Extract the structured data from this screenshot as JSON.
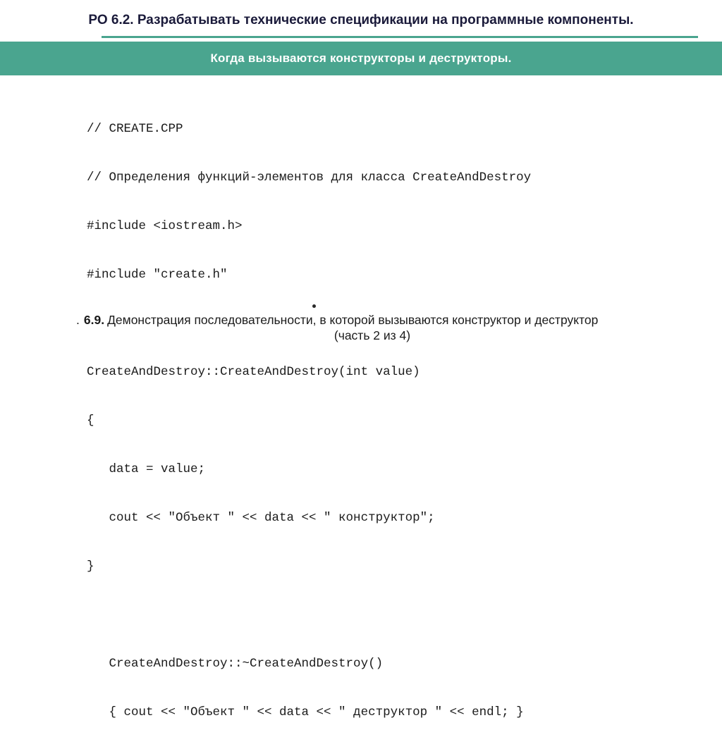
{
  "header": {
    "title": "РО 6.2. Разрабатывать технические спецификации на программные компоненты.",
    "accent_color": "#4aa58f"
  },
  "banner": {
    "text": "Когда вызываются конструкторы и деструкторы."
  },
  "code": {
    "lines": [
      "// CREATE.CPP",
      "// Определения функций-элементов для класса CreateAndDestroy",
      "#include <iostream.h>",
      "#include \"create.h\"",
      "",
      "CreateAndDestroy::CreateAndDestroy(int value)",
      "{",
      "   data = value;",
      "   cout << \"Объект \" << data << \" конструктор\";",
      "}",
      "",
      "   CreateAndDestroy::~CreateAndDestroy()",
      "   { cout << \"Объект \" << data << \" деструктор \" << endl; }"
    ]
  },
  "caption": {
    "prefix": ".",
    "number": "6.9.",
    "line1": "Демонстрация последовательности, в которой вызываются конструктор и деструктор",
    "line2": "(часть 2 из 4)"
  }
}
